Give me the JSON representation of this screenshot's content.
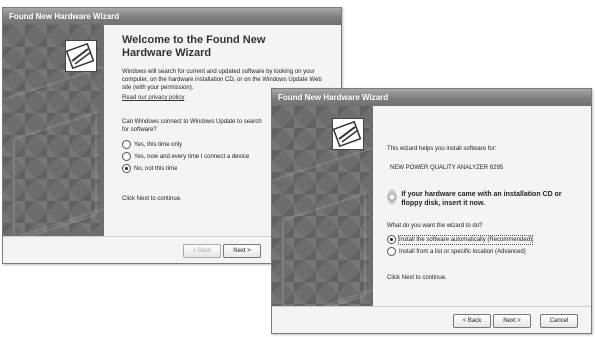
{
  "back": {
    "title": "Found New Hardware Wizard",
    "heading": "Welcome to the Found New Hardware Wizard",
    "intro": "Windows will search for current and updated software by looking on your computer, on the hardware installation CD, or on the Windows Update Web site (with your permission).",
    "privacy_link": "Read our privacy policy",
    "question": "Can Windows connect to Windows Update to search for software?",
    "options": [
      "Yes, this time only",
      "Yes, now and every time I connect a device",
      "No, not this time"
    ],
    "selected_index": 2,
    "footer_hint": "Click Next to continue.",
    "back_label": "< Back",
    "next_label": "Next >"
  },
  "front": {
    "title": "Found New Hardware Wizard",
    "intro": "This wizard helps you install software for:",
    "device": "NEW POWER QUALITY ANALYZER 8295",
    "cd_prompt": "If your hardware came with an installation CD or floppy disk, insert it now.",
    "question": "What do you want the wizard to do?",
    "options": [
      "Install the software automatically (Recommended)",
      "Install from a list or specific location (Advanced)"
    ],
    "selected_index": 0,
    "footer_hint": "Click Next to continue.",
    "back_label": "< Back",
    "next_label": "Next >",
    "cancel_label": "Cancel"
  }
}
